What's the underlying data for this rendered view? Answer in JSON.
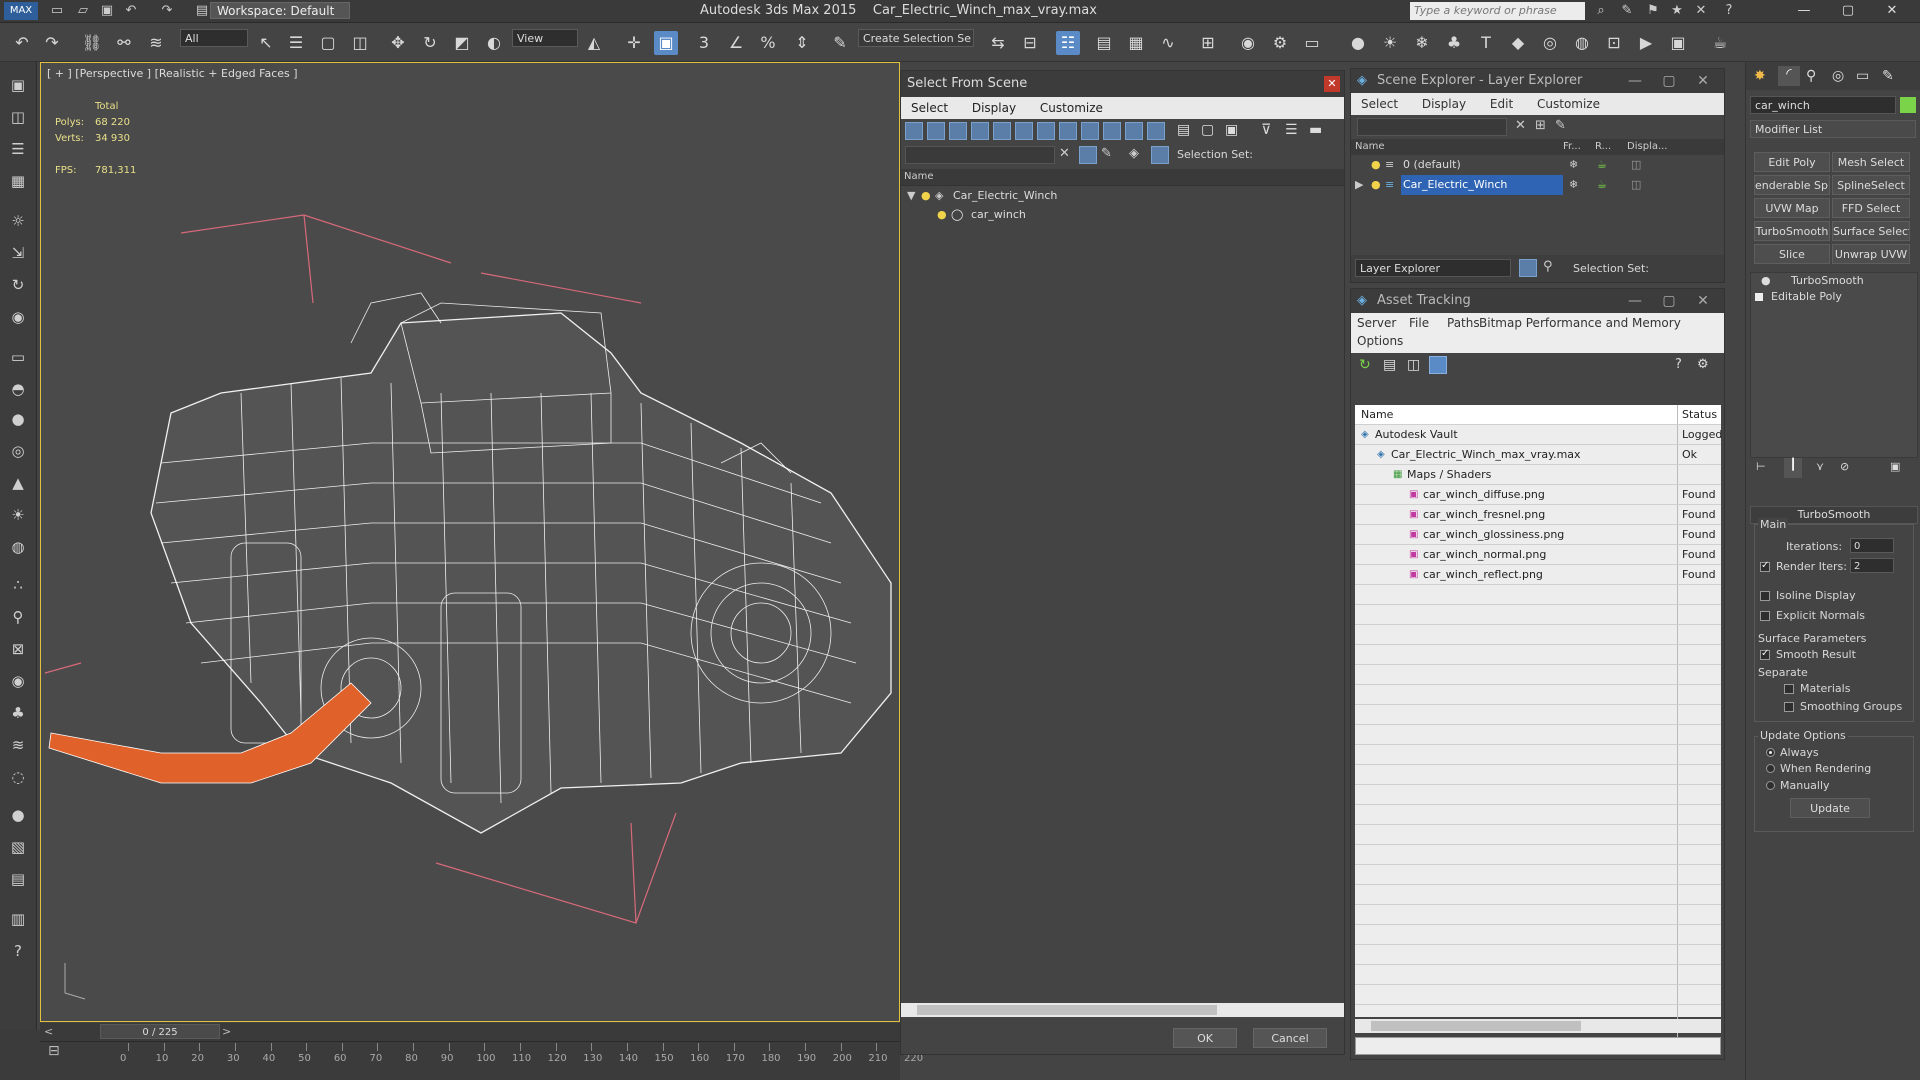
{
  "app": {
    "title": "Autodesk 3ds Max  2015",
    "file": "Car_Electric_Winch_max_vray.max",
    "workspace": "Workspace: Default",
    "search_placeholder": "Type a keyword or phrase"
  },
  "toolbar": {
    "filter": "All",
    "ref_coord": "View",
    "selection_set": "Create Selection Se"
  },
  "viewport": {
    "label": "[ + ] [Perspective ] [Realistic + Edged Faces ]",
    "stats_total": "Total",
    "polys_label": "Polys:",
    "polys_value": "68 220",
    "verts_label": "Verts:",
    "verts_value": "34 930",
    "fps_label": "FPS:",
    "fps_value": "781,311"
  },
  "timeline": {
    "frame": "0 / 225",
    "ticks": [
      "0",
      "10",
      "20",
      "30",
      "40",
      "50",
      "60",
      "70",
      "80",
      "90",
      "100",
      "110",
      "120",
      "130",
      "140",
      "150",
      "160",
      "170",
      "180",
      "190",
      "200",
      "210",
      "220"
    ]
  },
  "select_dialog": {
    "title": "Select From Scene",
    "menu": [
      "Select",
      "Display",
      "Customize"
    ],
    "selection_set_label": "Selection Set:",
    "column": "Name",
    "tree": [
      {
        "label": "Car_Electric_Winch"
      },
      {
        "label": "car_winch"
      }
    ],
    "ok": "OK",
    "cancel": "Cancel"
  },
  "scene_explorer": {
    "title": "Scene Explorer - Layer Explorer",
    "menu": [
      "Select",
      "Display",
      "Edit",
      "Customize"
    ],
    "columns": [
      "Name",
      "Fr...",
      "R...",
      "Displa..."
    ],
    "rows": [
      {
        "label": "0 (default)"
      },
      {
        "label": "Car_Electric_Winch"
      }
    ],
    "footer_dropdown": "Layer Explorer",
    "selection_set_label": "Selection Set:"
  },
  "asset_tracking": {
    "title": "Asset Tracking",
    "menu": [
      "Server",
      "File",
      "Paths",
      "Bitmap Performance and Memory"
    ],
    "menu2": "Options",
    "columns": [
      "Name",
      "Status"
    ],
    "rows": [
      {
        "name": "Autodesk Vault",
        "status": "Logged",
        "indent": 0,
        "icon": "vault-icon"
      },
      {
        "name": "Car_Electric_Winch_max_vray.max",
        "status": "Ok",
        "indent": 1,
        "icon": "max-file-icon"
      },
      {
        "name": "Maps / Shaders",
        "status": "",
        "indent": 2,
        "icon": "maps-icon"
      },
      {
        "name": "car_winch_diffuse.png",
        "status": "Found",
        "indent": 3,
        "icon": "png-icon"
      },
      {
        "name": "car_winch_fresnel.png",
        "status": "Found",
        "indent": 3,
        "icon": "png-icon"
      },
      {
        "name": "car_winch_glossiness.png",
        "status": "Found",
        "indent": 3,
        "icon": "png-icon"
      },
      {
        "name": "car_winch_normal.png",
        "status": "Found",
        "indent": 3,
        "icon": "png-icon"
      },
      {
        "name": "car_winch_reflect.png",
        "status": "Found",
        "indent": 3,
        "icon": "png-icon"
      }
    ]
  },
  "command_panel": {
    "object_name": "car_winch",
    "modifier_list": "Modifier List",
    "buttons": [
      "Edit Poly",
      "Mesh Select",
      "enderable Splir",
      "SplineSelect",
      "UVW Map",
      "FFD Select",
      "TurboSmooth",
      "Surface Select",
      "Slice",
      "Unwrap UVW"
    ],
    "stack": [
      "TurboSmooth",
      "Editable Poly"
    ],
    "rollout_title": "TurboSmooth",
    "main_label": "Main",
    "iterations_label": "Iterations:",
    "iterations_value": "0",
    "render_iters_label": "Render Iters:",
    "render_iters_value": "2",
    "isoline": "Isoline Display",
    "explicit_normals": "Explicit Normals",
    "surface_params": "Surface Parameters",
    "smooth_result": "Smooth Result",
    "separate": "Separate",
    "materials": "Materials",
    "smoothing_groups": "Smoothing Groups",
    "update_options": "Update Options",
    "always": "Always",
    "when_rendering": "When Rendering",
    "manually": "Manually",
    "update": "Update"
  },
  "colors": {
    "accent": "#5b8bc6",
    "object_swatch": "#7bd34a",
    "strap": "#e0622a"
  }
}
